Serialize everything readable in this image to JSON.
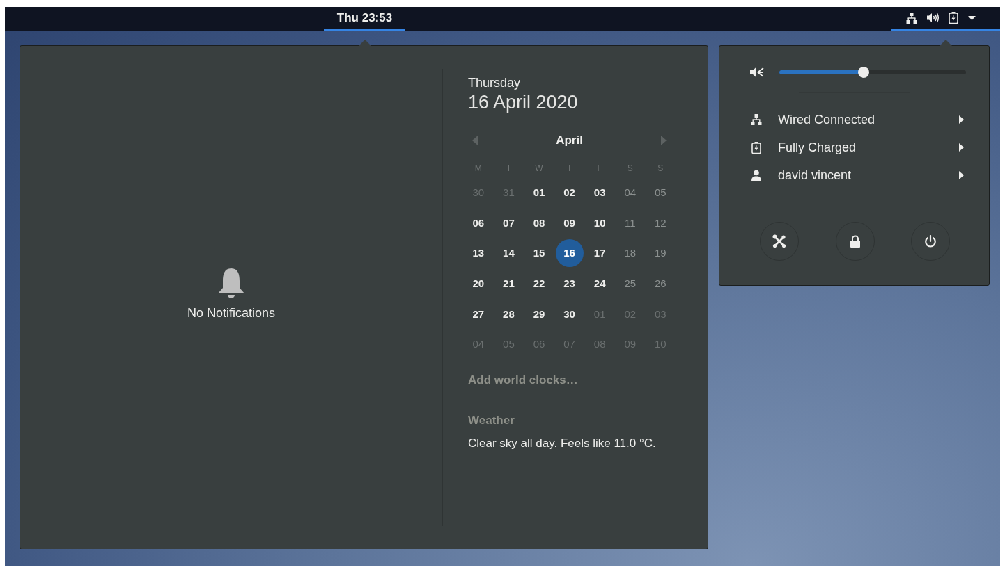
{
  "top_bar": {
    "clock": {
      "label": "Thu 23:53",
      "selected": true
    },
    "status_area": {
      "selected": true
    }
  },
  "notifications": {
    "empty_text": "No Notifications"
  },
  "calendar": {
    "weekday_name": "Thursday",
    "date": "16 April 2020",
    "month": "April",
    "weekday_headers": [
      "M",
      "T",
      "W",
      "T",
      "F",
      "S",
      "S"
    ],
    "days": [
      {
        "label": "30",
        "kind": "other-month",
        "selected": false
      },
      {
        "label": "31",
        "kind": "other-month",
        "selected": false
      },
      {
        "label": "01",
        "kind": "weekday",
        "selected": false
      },
      {
        "label": "02",
        "kind": "weekday",
        "selected": false
      },
      {
        "label": "03",
        "kind": "weekday",
        "selected": false
      },
      {
        "label": "04",
        "kind": "weekend",
        "selected": false
      },
      {
        "label": "05",
        "kind": "weekend",
        "selected": false
      },
      {
        "label": "06",
        "kind": "weekday",
        "selected": false
      },
      {
        "label": "07",
        "kind": "weekday",
        "selected": false
      },
      {
        "label": "08",
        "kind": "weekday",
        "selected": false
      },
      {
        "label": "09",
        "kind": "weekday",
        "selected": false
      },
      {
        "label": "10",
        "kind": "weekday",
        "selected": false
      },
      {
        "label": "11",
        "kind": "weekend",
        "selected": false
      },
      {
        "label": "12",
        "kind": "weekend",
        "selected": false
      },
      {
        "label": "13",
        "kind": "weekday",
        "selected": false
      },
      {
        "label": "14",
        "kind": "weekday",
        "selected": false
      },
      {
        "label": "15",
        "kind": "weekday",
        "selected": false
      },
      {
        "label": "16",
        "kind": "weekday",
        "selected": true
      },
      {
        "label": "17",
        "kind": "weekday",
        "selected": false
      },
      {
        "label": "18",
        "kind": "weekend",
        "selected": false
      },
      {
        "label": "19",
        "kind": "weekend",
        "selected": false
      },
      {
        "label": "20",
        "kind": "weekday",
        "selected": false
      },
      {
        "label": "21",
        "kind": "weekday",
        "selected": false
      },
      {
        "label": "22",
        "kind": "weekday",
        "selected": false
      },
      {
        "label": "23",
        "kind": "weekday",
        "selected": false
      },
      {
        "label": "24",
        "kind": "weekday",
        "selected": false
      },
      {
        "label": "25",
        "kind": "weekend",
        "selected": false
      },
      {
        "label": "26",
        "kind": "weekend",
        "selected": false
      },
      {
        "label": "27",
        "kind": "weekday",
        "selected": false
      },
      {
        "label": "28",
        "kind": "weekday",
        "selected": false
      },
      {
        "label": "29",
        "kind": "weekday",
        "selected": false
      },
      {
        "label": "30",
        "kind": "weekday",
        "selected": false
      },
      {
        "label": "01",
        "kind": "other-month",
        "selected": false
      },
      {
        "label": "02",
        "kind": "other-month",
        "selected": false
      },
      {
        "label": "03",
        "kind": "other-month",
        "selected": false
      },
      {
        "label": "04",
        "kind": "other-month",
        "selected": false
      },
      {
        "label": "05",
        "kind": "other-month",
        "selected": false
      },
      {
        "label": "06",
        "kind": "other-month",
        "selected": false
      },
      {
        "label": "07",
        "kind": "other-month",
        "selected": false
      },
      {
        "label": "08",
        "kind": "other-month",
        "selected": false
      },
      {
        "label": "09",
        "kind": "other-month",
        "selected": false
      },
      {
        "label": "10",
        "kind": "other-month",
        "selected": false
      }
    ]
  },
  "world_clocks": {
    "link": "Add world clocks…"
  },
  "weather": {
    "title": "Weather",
    "summary": "Clear sky all day. Feels like 11.0 °C."
  },
  "system_menu": {
    "volume": {
      "level": 0.45
    },
    "items": [
      {
        "kind": "network",
        "label": "Wired Connected"
      },
      {
        "kind": "battery",
        "label": "Fully Charged"
      },
      {
        "kind": "user",
        "label": "david vincent"
      }
    ],
    "actions": [
      {
        "kind": "settings"
      },
      {
        "kind": "lock"
      },
      {
        "kind": "power"
      }
    ]
  }
}
